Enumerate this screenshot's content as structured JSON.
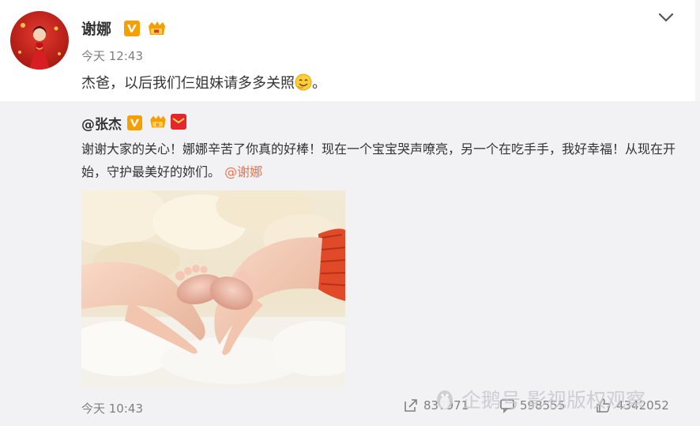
{
  "post": {
    "author": "谢娜",
    "time": "今天 12:43",
    "text": "杰爸，以后我们仨姐妹请多多关照",
    "text_end": "。",
    "avatar_icon": "avatar-red-dress",
    "verified_icon": "v-badge-icon",
    "member_icon": "crown-icon"
  },
  "original": {
    "author": "@张杰",
    "text": "谢谢大家的关心！娜娜辛苦了你真的好棒！现在一个宝宝哭声嘹亮，另一个在吃手手，我好幸福！从现在开始，守护最美好的妳们。",
    "mention": "@谢娜",
    "photo_desc": "baby-feet-heart-hands-photo",
    "time": "今天 10:43",
    "stats": {
      "repost": "837971",
      "comment": "598555",
      "like": "4342052"
    }
  },
  "watermark": "企鹅号 影视版权观察",
  "colors": {
    "accent": "#eb7350",
    "text": "#333333",
    "muted": "#808080",
    "repost_bg": "#f2f2f5",
    "verified": "#f5a000"
  }
}
